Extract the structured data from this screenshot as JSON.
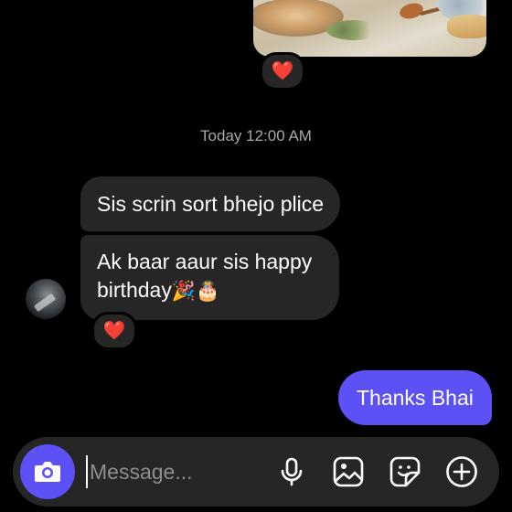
{
  "thread": {
    "shared_image_reaction": "❤️",
    "timestamp": "Today 12:00 AM",
    "incoming": [
      {
        "text": "Sis scrin sort bhejo plice"
      },
      {
        "text": "Ak baar aaur sis happy birthday",
        "emoji": "🎉🎂",
        "reaction": "❤️"
      }
    ],
    "outgoing": [
      {
        "text": "Thanks Bhai"
      }
    ]
  },
  "composer": {
    "placeholder": "Message...",
    "value": "",
    "icons": [
      "camera-icon",
      "microphone-icon",
      "gallery-icon",
      "sticker-icon",
      "plus-icon"
    ]
  },
  "colors": {
    "background": "#000000",
    "incoming_bubble": "#262626",
    "outgoing_bubble": "#5b51f5",
    "accent": "#5b51f5",
    "timestamp": "#a8a8a8",
    "reaction_heart": "#ff3040"
  }
}
